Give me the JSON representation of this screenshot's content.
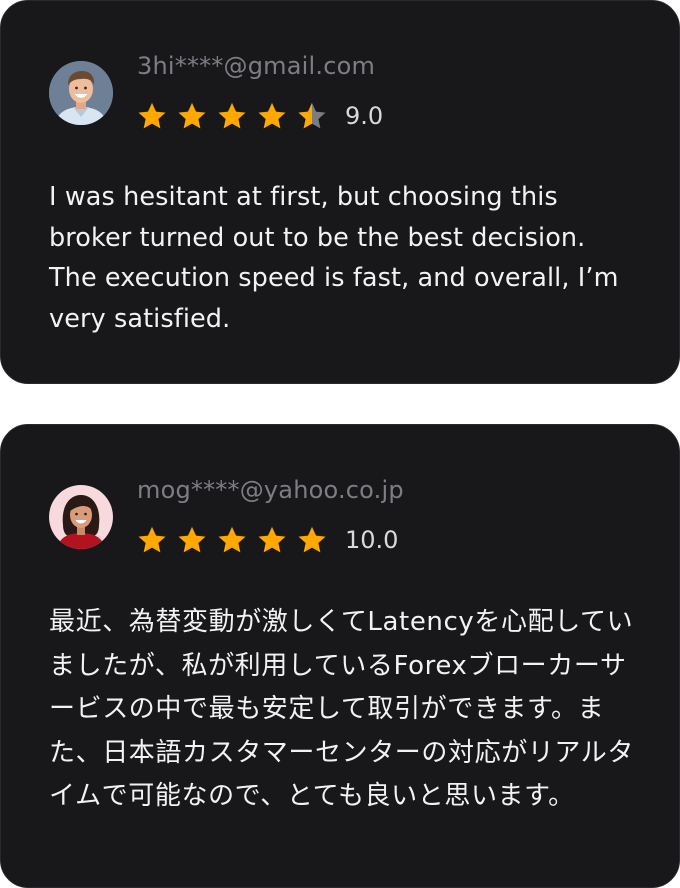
{
  "colors": {
    "card_background": "#18181b",
    "email_text": "#7d7d84",
    "score_text": "#d9d9dc",
    "body_text": "#f2f2f2",
    "star_filled": "#ffa800",
    "star_empty": "#7b7b82"
  },
  "reviews": [
    {
      "avatar_icon": "male-user-avatar",
      "email": "3hi****@gmail.com",
      "rating": 4.5,
      "score": "9.0",
      "text": "I was hesitant at first, but choosing this broker turned out to be the best decision. The execution speed is fast, and overall, I’m very satisfied."
    },
    {
      "avatar_icon": "female-user-avatar",
      "email": "mog****@yahoo.co.jp",
      "rating": 5,
      "score": "10.0",
      "text": "最近、為替変動が激しくてLatencyを心配していましたが、私が利用しているForexブローカーサービスの中で最も安定して取引ができます。また、日本語カスタマーセンターの対応がリアルタイムで可能なので、とても良いと思います。"
    }
  ]
}
